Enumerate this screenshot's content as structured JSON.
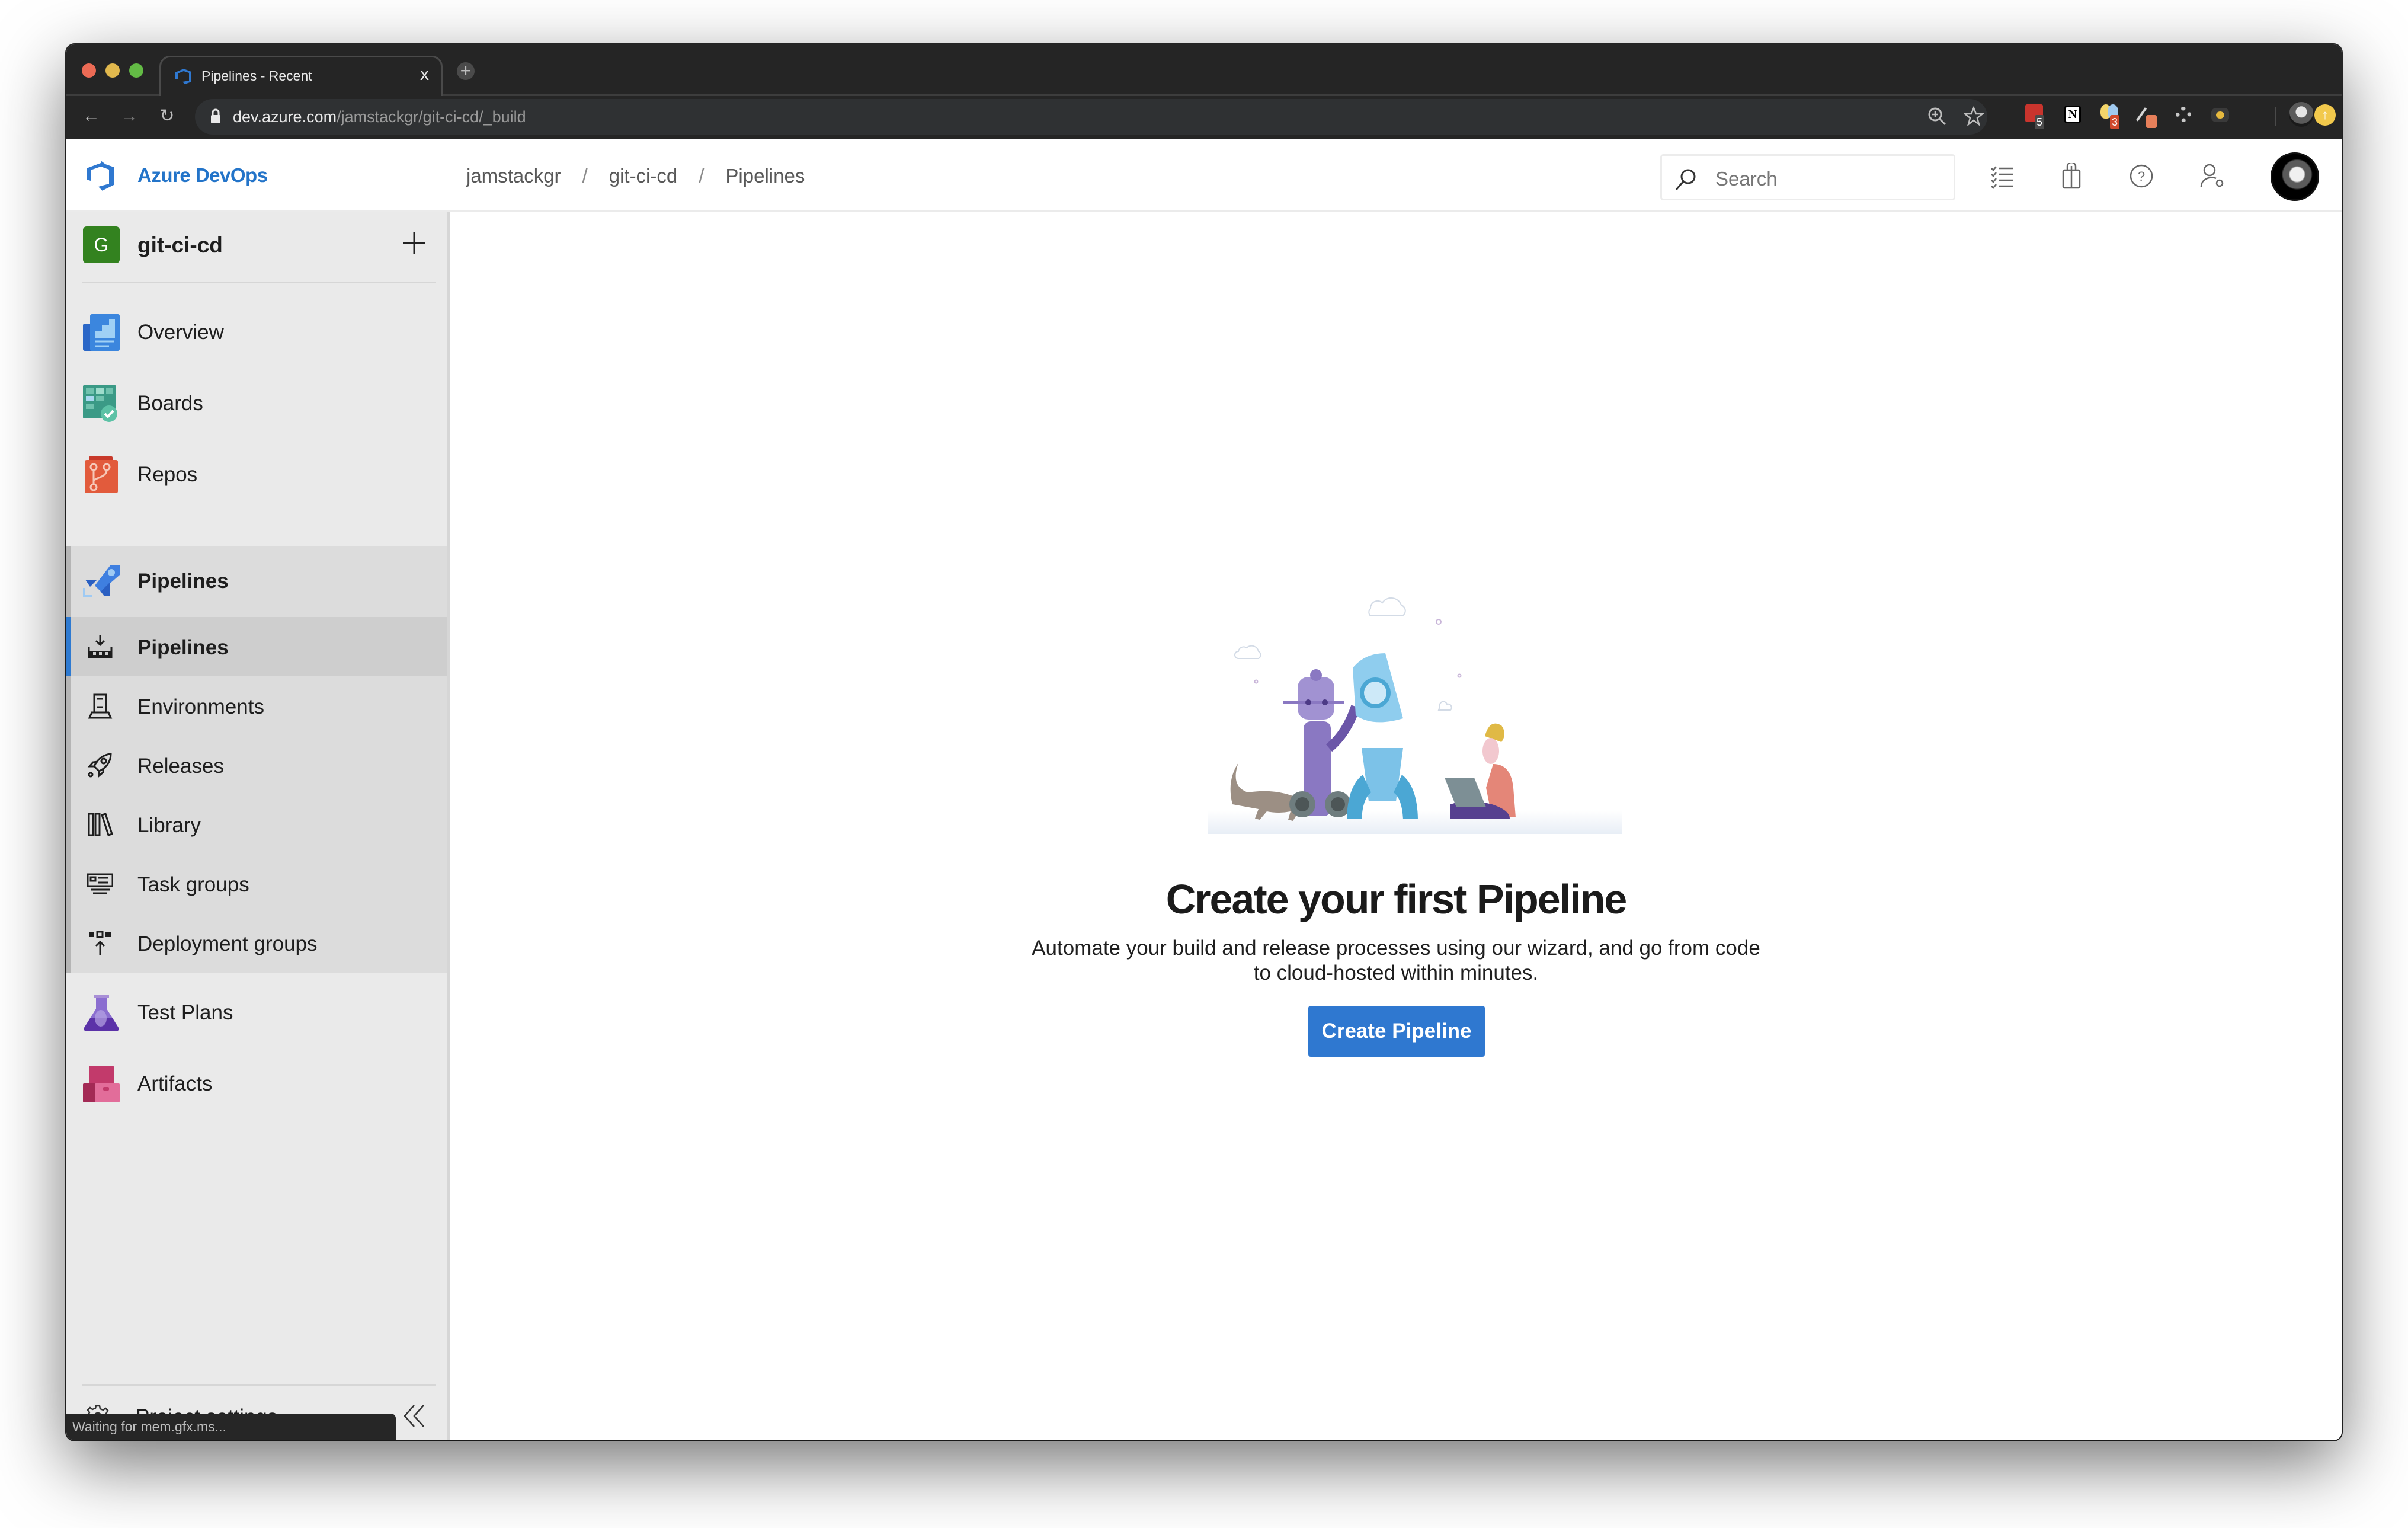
{
  "browser": {
    "tab_title": "Pipelines - Recent",
    "tab_close": "x",
    "new_tab": "+",
    "url_domain": "dev.azure.com",
    "url_path": "/jamstackgr/git-ci-cd/_build",
    "extension_badges": {
      "lastpass": "5",
      "ideas": "3"
    },
    "status_text": "Waiting for mem.gfx.ms..."
  },
  "header": {
    "product": "Azure DevOps",
    "breadcrumb": [
      "jamstackgr",
      "git-ci-cd",
      "Pipelines"
    ],
    "search_placeholder": "Search"
  },
  "sidebar": {
    "project_initial": "G",
    "project_name": "git-ci-cd",
    "items": [
      {
        "label": "Overview",
        "icon": "overview-icon"
      },
      {
        "label": "Boards",
        "icon": "boards-icon"
      },
      {
        "label": "Repos",
        "icon": "repos-icon"
      },
      {
        "label": "Pipelines",
        "icon": "pipelines-icon"
      },
      {
        "label": "Test Plans",
        "icon": "test-plans-icon"
      },
      {
        "label": "Artifacts",
        "icon": "artifacts-icon"
      }
    ],
    "pipelines_sub": [
      {
        "label": "Pipelines",
        "icon": "pipelines-build-icon",
        "selected": true
      },
      {
        "label": "Environments",
        "icon": "environments-icon"
      },
      {
        "label": "Releases",
        "icon": "rocket-icon"
      },
      {
        "label": "Library",
        "icon": "library-icon"
      },
      {
        "label": "Task groups",
        "icon": "task-groups-icon"
      },
      {
        "label": "Deployment groups",
        "icon": "deployment-groups-icon"
      }
    ],
    "settings_label": "Project settings"
  },
  "main": {
    "title": "Create your first Pipeline",
    "description": "Automate your build and release processes using our wizard, and go from code to cloud-hosted within minutes.",
    "create_button": "Create Pipeline"
  },
  "colors": {
    "accent": "#2f78d0",
    "brand_text": "#2374c9",
    "project_badge": "#33821f"
  }
}
